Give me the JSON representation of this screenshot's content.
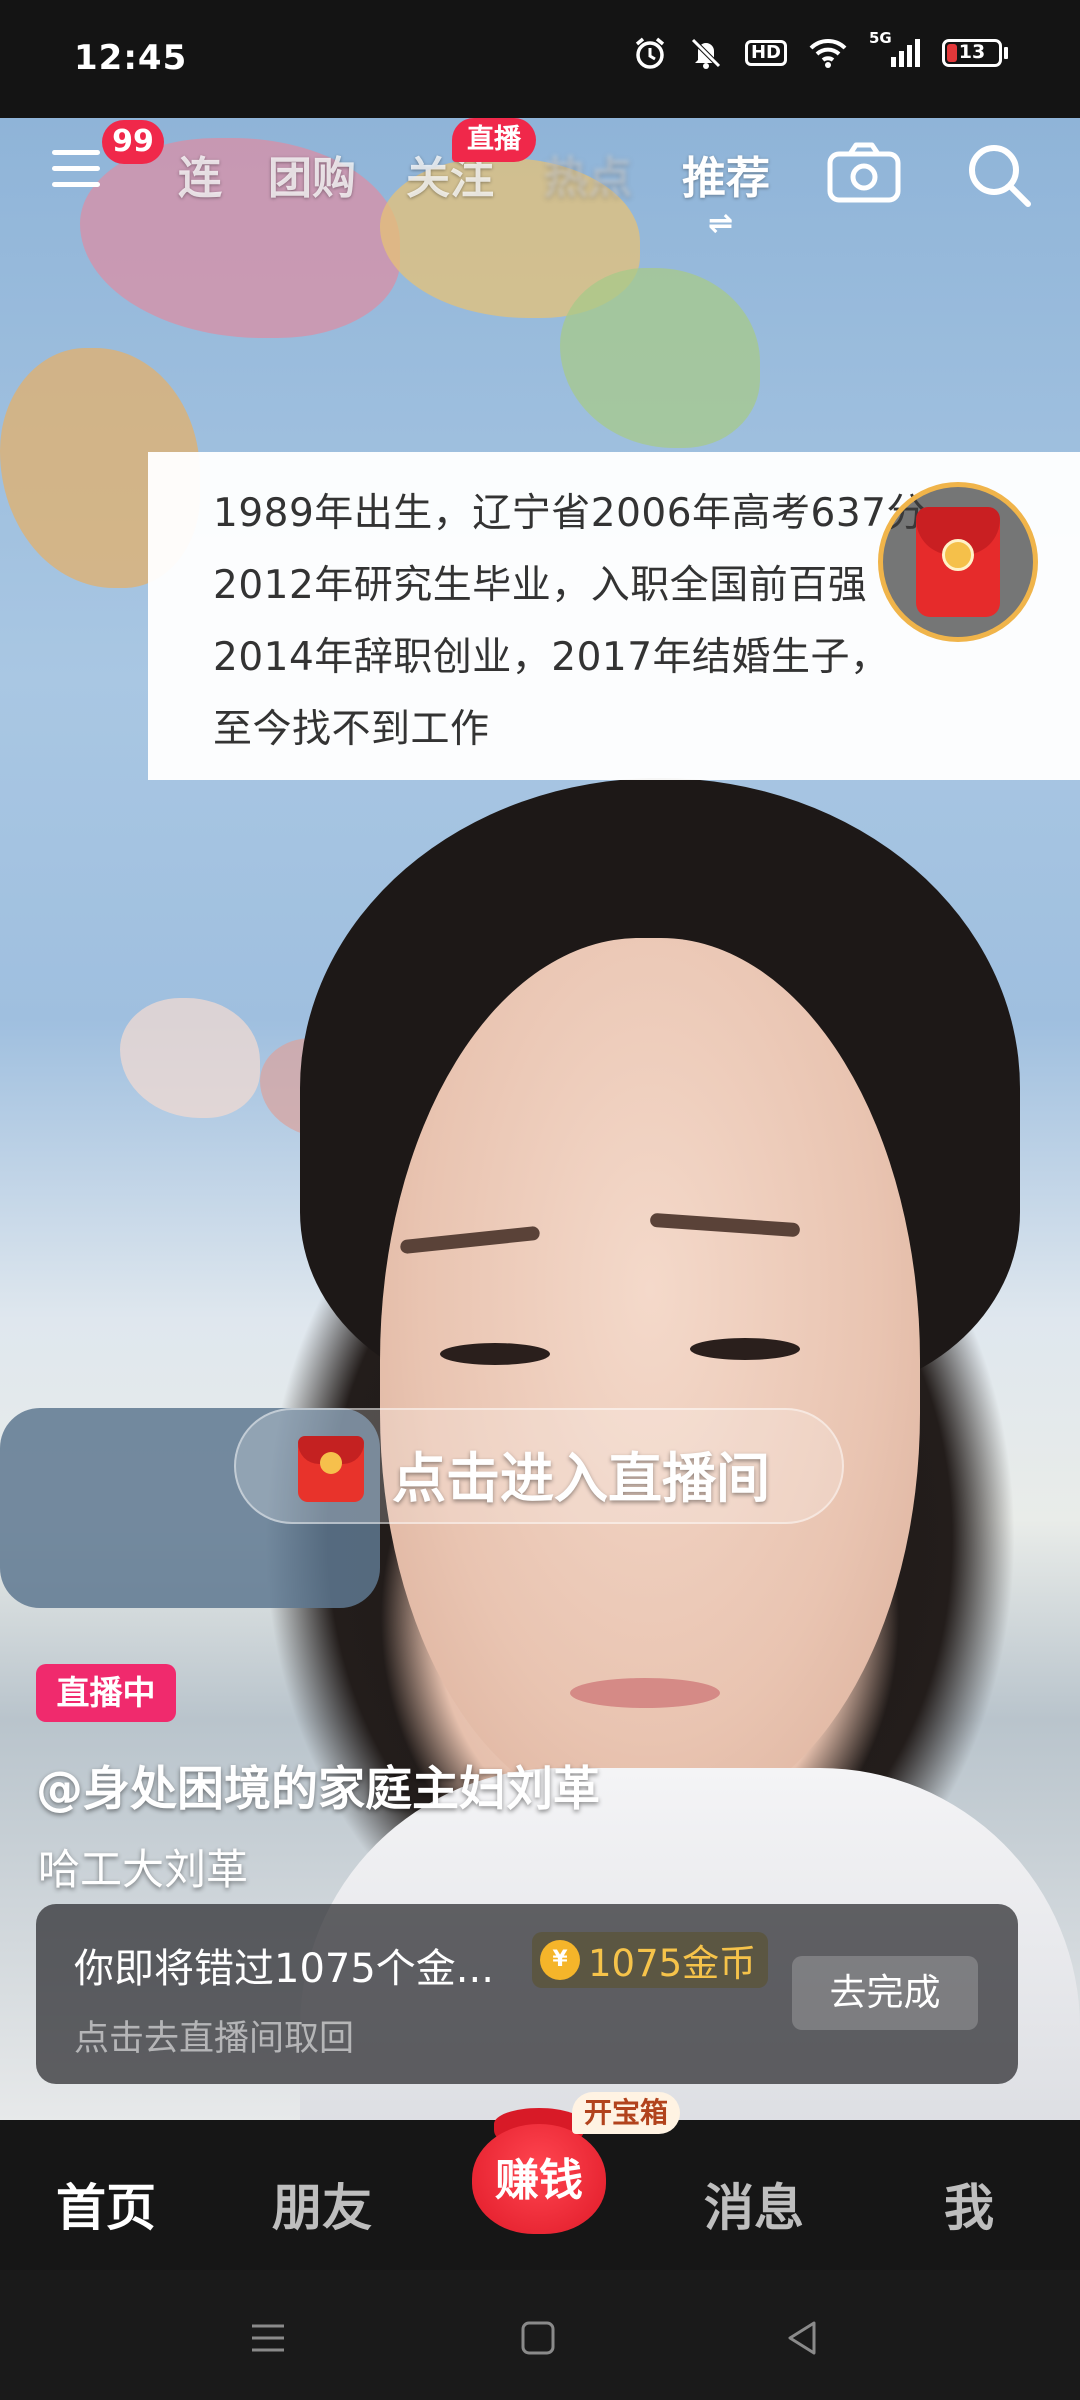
{
  "status_bar": {
    "time": "12:45",
    "network": "5G",
    "battery_percent": "13",
    "hd_label": "HD",
    "icons": [
      "alarm-icon",
      "mute-icon",
      "hd-icon",
      "wifi-icon",
      "signal-icon",
      "battery-icon"
    ]
  },
  "top_nav": {
    "menu_badge": "99",
    "tabs": [
      {
        "label": "连"
      },
      {
        "label": "团购"
      },
      {
        "label": "关注"
      },
      {
        "label": "热点"
      },
      {
        "label": "推荐"
      }
    ],
    "follow_live_badge": "直播",
    "active_indicator": "⇌"
  },
  "caption": {
    "lines": [
      "1989年出生，辽宁省2006年高考637分",
      "2012年研究生毕业，入职全国前百强",
      "2014年辞职创业，2017年结婚生子，",
      "至今找不到工作"
    ]
  },
  "live_entry": {
    "label": "点击进入直播间"
  },
  "stream": {
    "status": "直播中",
    "host_name": "@身处困境的家庭主妇刘革",
    "host_subtitle": "哈工大刘革"
  },
  "task_card": {
    "title": "你即将错过1075个金...",
    "coin_symbol": "¥",
    "coin_amount": "1075金币",
    "subtitle": "点击去直播间取回",
    "button": "去完成"
  },
  "bottom_nav": {
    "home": "首页",
    "friends": "朋友",
    "earn": "赚钱",
    "chest_badge": "开宝箱",
    "messages": "消息",
    "me": "我"
  },
  "colors": {
    "accent_red": "#f0284a",
    "live_pink": "#f02a6d",
    "coin_gold": "#f6c34a",
    "nav_bg": "#161616"
  }
}
